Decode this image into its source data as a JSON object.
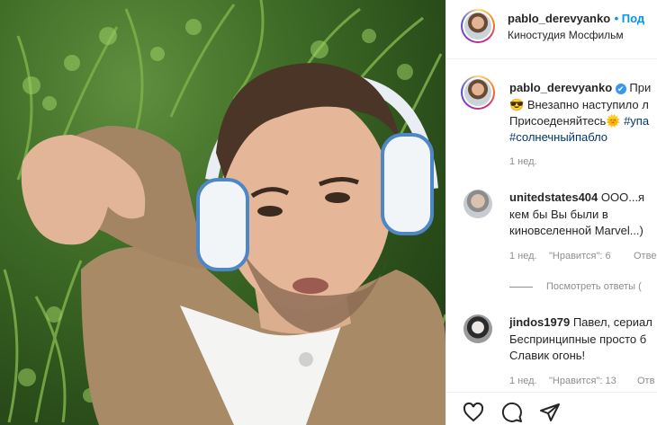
{
  "post": {
    "author": "pablo_derevyanko",
    "follow_label": "• Под",
    "location": "Киностудия Мосфильм"
  },
  "caption": {
    "author": "pablo_derevyanko",
    "verified_mark": "✔",
    "lead": "При",
    "line1_emoji": "😎",
    "line1_text": "Внезапно наступило л",
    "line2_text": "Присоеденяйтесь",
    "line2_emoji": "🌞",
    "line2_tag": "#упа",
    "line3_tag": "#солнечныйпабло",
    "time": "1 нед."
  },
  "comments": [
    {
      "author": "unitedstates404",
      "line1": "ООО...я",
      "line2": "кем бы Вы были в",
      "line3": "киновселенной Marvel...)",
      "time": "1 нед.",
      "likes": "\"Нравится\": 6",
      "reply": "Отве",
      "view_replies": "Посмотреть ответы ("
    },
    {
      "author": "jindos1979",
      "line1": "Павел, сериал",
      "line2": "Беспринципные просто б",
      "line3": "Славик огонь!",
      "time": "1 нед.",
      "likes": "\"Нравится\": 13",
      "reply": "Отв"
    }
  ],
  "icons": {
    "like": "heart-icon",
    "comment": "comment-icon",
    "share": "share-icon"
  },
  "colors": {
    "link": "#00376b",
    "follow": "#0095f6",
    "meta": "#8e8e8e"
  }
}
